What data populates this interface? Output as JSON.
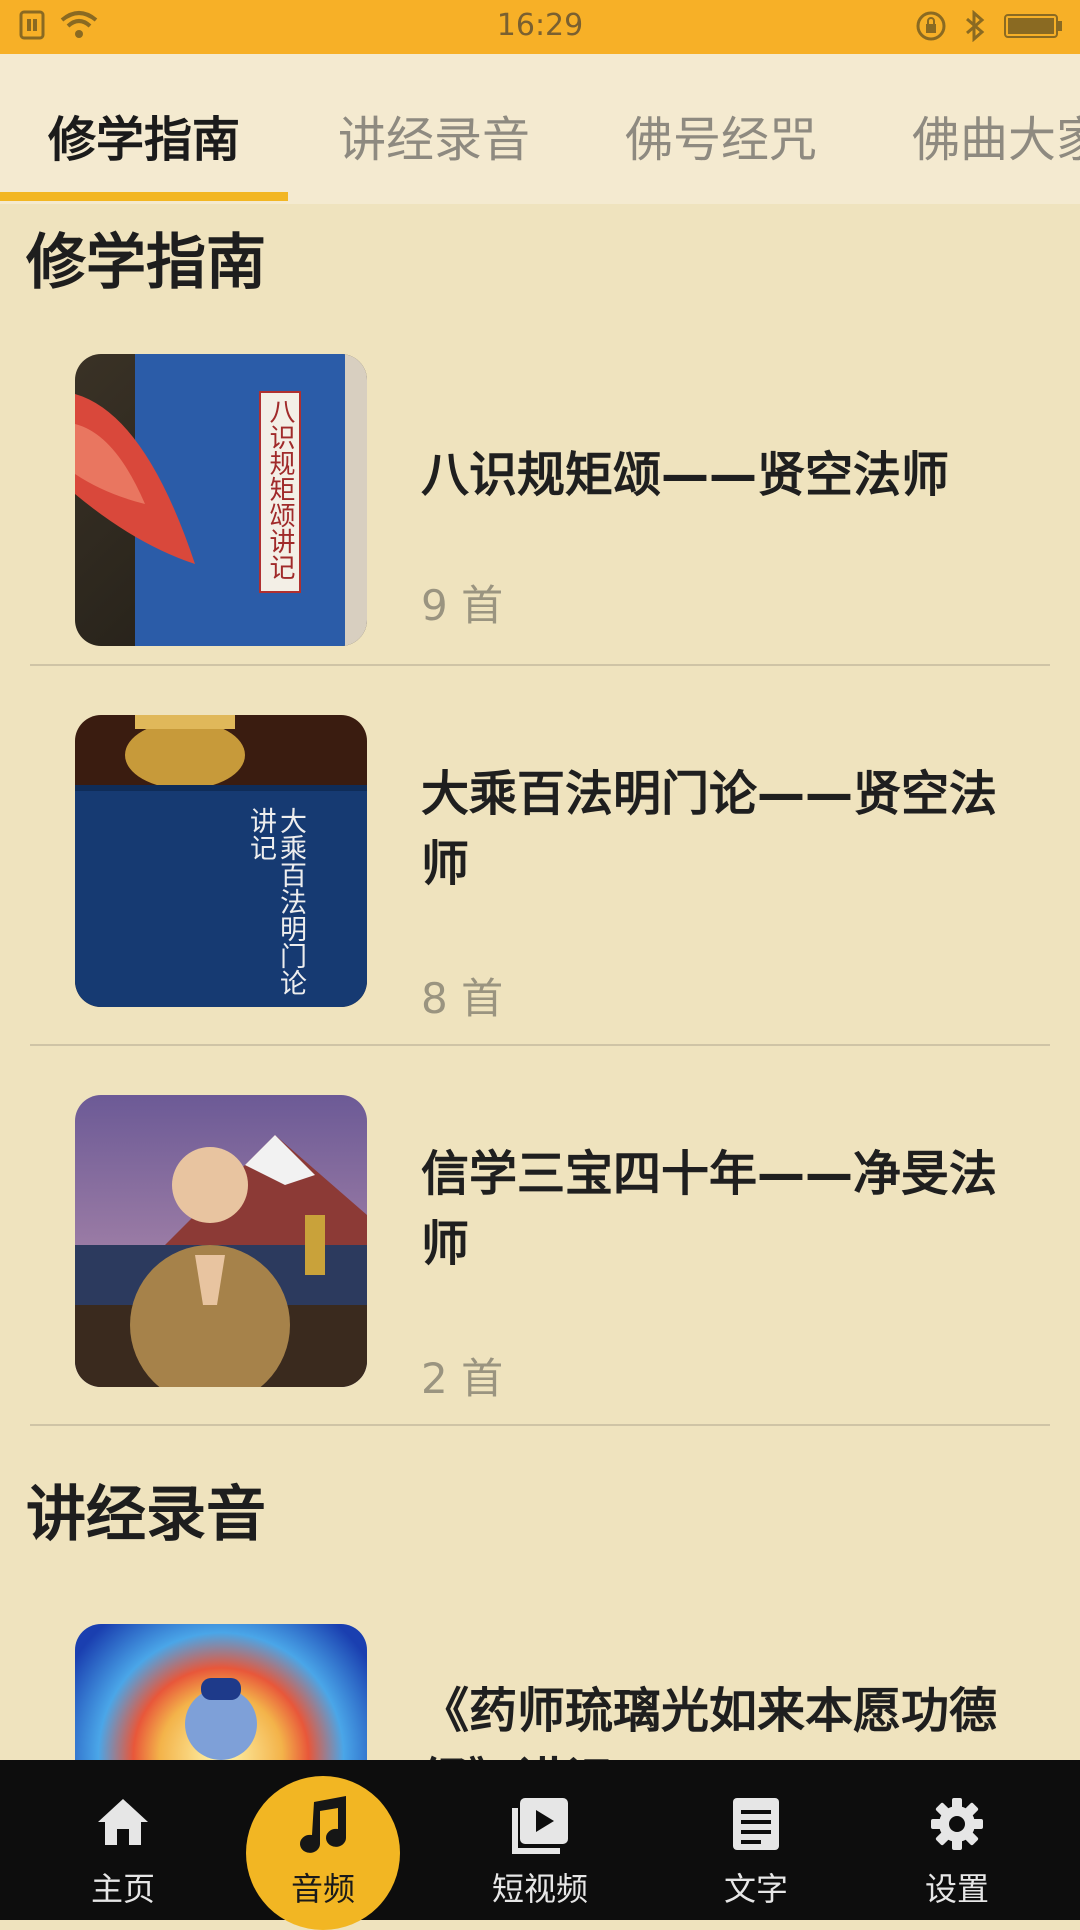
{
  "status_bar": {
    "time": "16:29"
  },
  "tabs": [
    {
      "label": "修学指南",
      "active": true
    },
    {
      "label": "讲经录音",
      "active": false
    },
    {
      "label": "佛号经咒",
      "active": false
    },
    {
      "label": "佛曲大家",
      "active": false
    }
  ],
  "sections": [
    {
      "title": "修学指南",
      "items": [
        {
          "title": "八识规矩颂——贤空法师",
          "count": "9 首",
          "thumb_text": "八识规矩颂讲记"
        },
        {
          "title": "大乘百法明门论——贤空法师",
          "count": "8 首",
          "thumb_text": "大乘百法明门论讲记"
        },
        {
          "title": "信学三宝四十年——净旻法师",
          "count": "2 首"
        }
      ]
    },
    {
      "title": "讲经录音",
      "items": [
        {
          "title": "《药师琉璃光如来本愿功德经》讲记",
          "count": ""
        }
      ]
    }
  ],
  "bottom_nav": [
    {
      "label": "主页",
      "icon": "home-icon",
      "active": false
    },
    {
      "label": "音频",
      "icon": "music-note-icon",
      "active": true
    },
    {
      "label": "短视频",
      "icon": "video-icon",
      "active": false
    },
    {
      "label": "文字",
      "icon": "document-icon",
      "active": false
    },
    {
      "label": "设置",
      "icon": "gear-icon",
      "active": false
    }
  ],
  "colors": {
    "accent": "#f2b623",
    "status_bar": "#f7b027",
    "background": "#efe3be",
    "nav_background": "#0d0d0d"
  }
}
